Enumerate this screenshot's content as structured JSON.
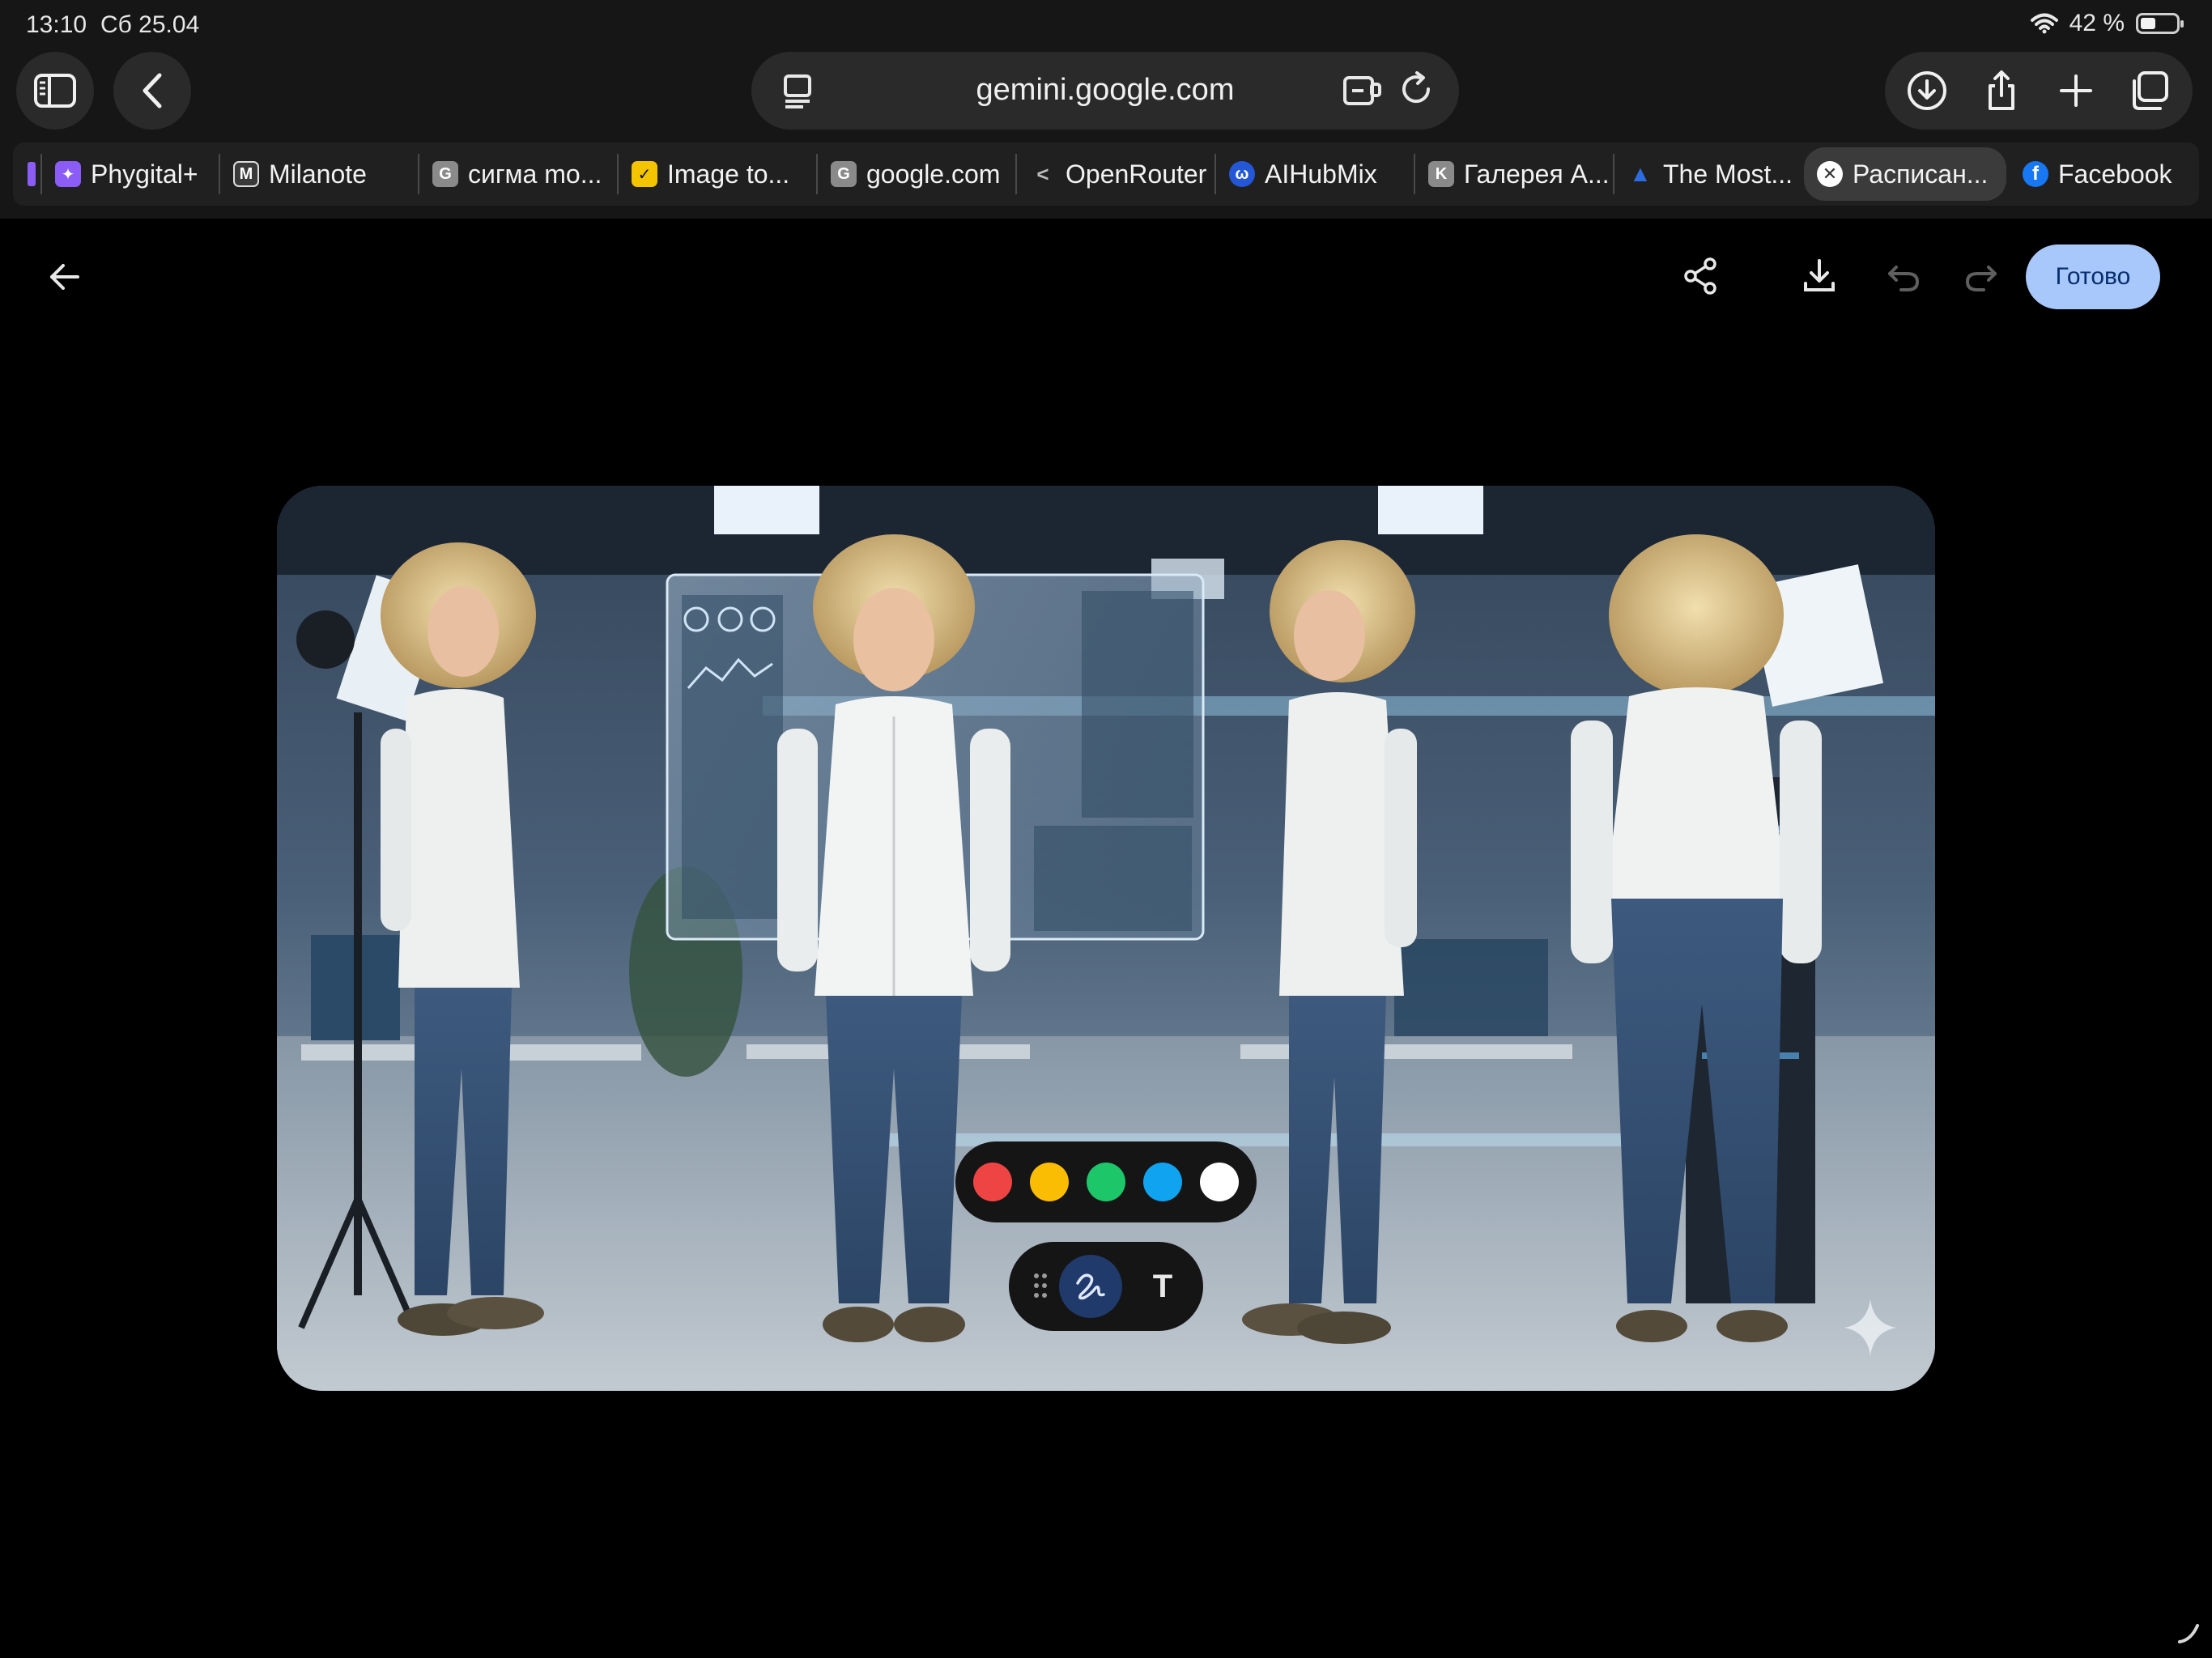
{
  "status_bar": {
    "time": "13:10",
    "date": "Сб 25.04",
    "battery_text": "42 %",
    "battery_level": 0.42
  },
  "browser": {
    "url": "gemini.google.com",
    "tabs": [
      {
        "label": "Phygital+",
        "icon": "phygital-icon",
        "color": "#8b5cf6"
      },
      {
        "label": "Milanote",
        "icon": "milanote-icon",
        "color": "#3a3a3a"
      },
      {
        "label": "сигма mo...",
        "icon": "generic-g-icon",
        "color": "#8a8a8a"
      },
      {
        "label": "Image to...",
        "icon": "check-icon",
        "color": "#f5c400"
      },
      {
        "label": "google.com",
        "icon": "generic-g-icon",
        "color": "#8a8a8a"
      },
      {
        "label": "OpenRouter",
        "icon": "openrouter-icon",
        "color": "#3a3a3a"
      },
      {
        "label": "AIHubMix",
        "icon": "aihubmix-icon",
        "color": "#2457d6"
      },
      {
        "label": "Галерея А...",
        "icon": "generic-k-icon",
        "color": "#8a8a8a"
      },
      {
        "label": "The Most...",
        "icon": "triangle-icon",
        "color": "#2d6cdf"
      },
      {
        "label": "Расписан...",
        "icon": "close-circle-icon",
        "color": "#ffffff",
        "active": true
      },
      {
        "label": "Facebook",
        "icon": "facebook-icon",
        "color": "#1877f2"
      }
    ]
  },
  "editor": {
    "done_label": "Готово",
    "palette": [
      {
        "name": "red",
        "color": "#ef4444"
      },
      {
        "name": "yellow",
        "color": "#fbbc04"
      },
      {
        "name": "green",
        "color": "#1ec66a"
      },
      {
        "name": "blue",
        "color": "#10a3f0"
      },
      {
        "name": "white",
        "color": "#ffffff"
      }
    ],
    "text_tool_label": "T"
  }
}
